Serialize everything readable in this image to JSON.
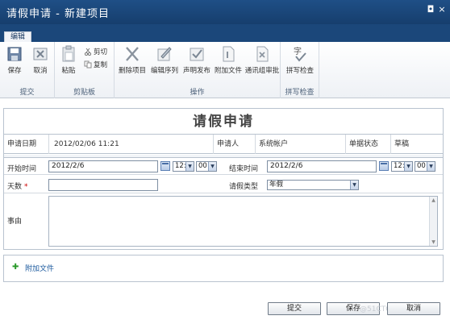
{
  "window": {
    "title": "请假申请 - 新建项目",
    "close_glyph": "×",
    "restore_glyph": "◘"
  },
  "ribbon": {
    "tab": "编辑",
    "groups": [
      {
        "label": "提交",
        "buttons": [
          "保存",
          "取消"
        ]
      },
      {
        "label": "剪贴板",
        "buttons": [
          "粘贴",
          "剪切",
          "复制"
        ]
      },
      {
        "label": "操作",
        "buttons": [
          "删除项目",
          "编辑序列",
          "声明发布",
          "附加文件",
          "通讯组审批"
        ]
      },
      {
        "label": "拼写检查",
        "buttons": [
          "拼写检查"
        ]
      }
    ]
  },
  "form": {
    "title": "请假申请",
    "header": {
      "apply_date_label": "申请日期",
      "apply_date_value": "2012/02/06 11:21",
      "applicant_label": "申请人",
      "applicant_value": "系统帐户",
      "status_label": "单据状态",
      "status_value": "草稿"
    },
    "start_label": "开始时间",
    "start_date": "2012/2/6",
    "start_hour": "12:",
    "start_min": "00",
    "end_label": "结束时间",
    "end_date": "2012/2/6",
    "end_hour": "12:",
    "end_min": "00",
    "days_label": "天数",
    "required_mark": "*",
    "days_value": "",
    "type_label": "请假类型",
    "type_value": "年假",
    "reason_label": "事由",
    "reason_value": ""
  },
  "attach": {
    "label": "附加文件"
  },
  "buttons": {
    "submit": "提交",
    "save": "保存",
    "cancel": "取消"
  },
  "watermark": "@51CTO博客"
}
